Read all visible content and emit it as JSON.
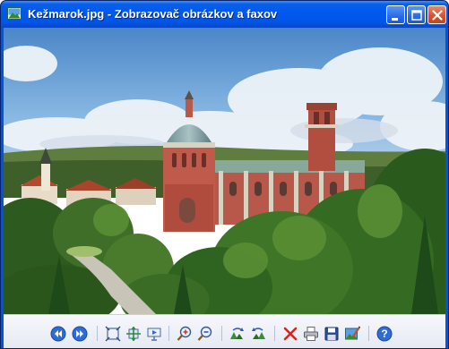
{
  "window": {
    "title": "Kežmarok.jpg - Zobrazovač obrázkov a faxov",
    "accent_color": "#0054e3",
    "caption_buttons": [
      "minimize-icon",
      "maximize-icon",
      "close-icon"
    ]
  },
  "image": {
    "subject": "photo-town-church"
  },
  "toolbar": {
    "buttons": [
      "previous-image-icon",
      "next-image-icon",
      "best-fit-icon",
      "actual-size-icon",
      "slideshow-icon",
      "zoom-in-icon",
      "zoom-out-icon",
      "rotate-clockwise-icon",
      "rotate-counterclockwise-icon",
      "delete-icon",
      "print-icon",
      "save-copy-icon",
      "open-for-editing-icon",
      "help-icon"
    ]
  }
}
